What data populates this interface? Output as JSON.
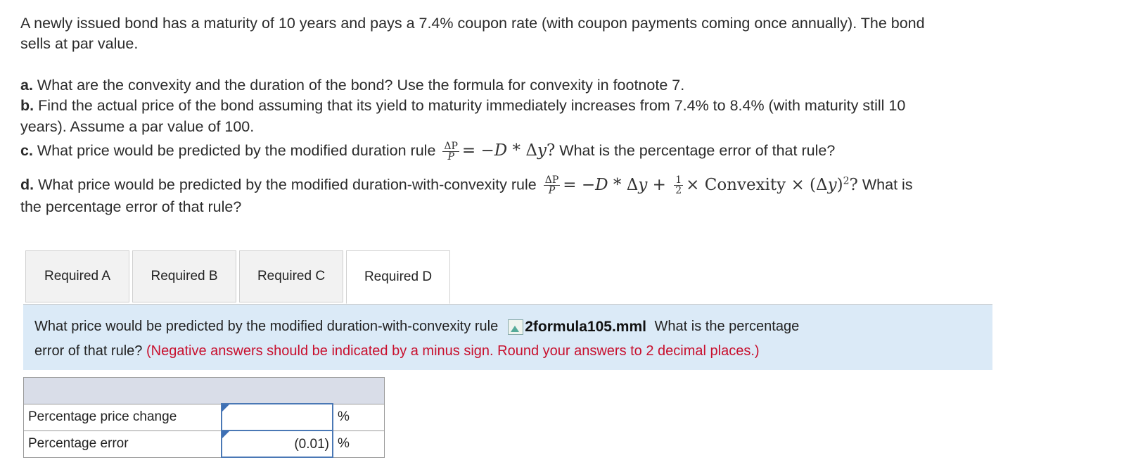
{
  "question": {
    "intro_line1": "A newly issued bond has a maturity of 10 years and pays a 7.4% coupon rate (with coupon payments coming once annually). The bond",
    "intro_line2": "sells at par value.",
    "a_label": "a.",
    "a_text": " What are the convexity and the duration of the bond? Use the formula for convexity in footnote 7.",
    "b_label": "b.",
    "b_text_line1": " Find the actual price of the bond assuming that its yield to maturity immediately increases from 7.4% to 8.4% (with maturity still 10",
    "b_text_line2": "years). Assume a par value of 100.",
    "c_label": "c.",
    "c_text_before": " What price would be predicted by the modified duration rule",
    "c_text_after": " What is the percentage error of that rule?",
    "d_label": "d.",
    "d_text_before": " What price would be predicted by the modified duration-with-convexity rule",
    "d_text_after": " What is",
    "d_text_line2": "the percentage error of that rule?"
  },
  "tabs": [
    {
      "label": "Required A",
      "active": false
    },
    {
      "label": "Required B",
      "active": false
    },
    {
      "label": "Required C",
      "active": false
    },
    {
      "label": "Required D",
      "active": true
    }
  ],
  "panel": {
    "text_before": "What price would be predicted by the modified duration-with-convexity rule",
    "image_alt": "2formula105.mml",
    "text_after": " What is the percentage",
    "text_line2": "error of that rule?",
    "instruction": "(Negative answers should be indicated by a minus sign. Round your answers to 2 decimal places.)"
  },
  "answer_table": {
    "rows": [
      {
        "label": "Percentage price change",
        "value": "",
        "unit": "%"
      },
      {
        "label": "Percentage error",
        "value": "(0.01)",
        "unit": "%"
      }
    ]
  },
  "colors": {
    "panel_bg": "#dbeaf7",
    "instruction_red": "#c8102e",
    "input_border": "#4a78b5",
    "table_header": "#d9dde8"
  }
}
